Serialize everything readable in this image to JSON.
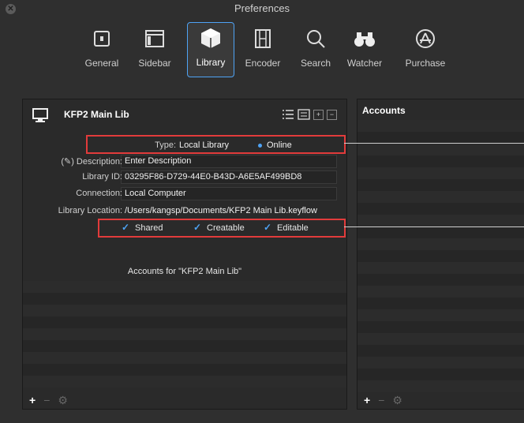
{
  "window": {
    "title": "Preferences",
    "close_glyph": "✕"
  },
  "toolbar": {
    "items": [
      {
        "label": "General",
        "icon": "general-icon"
      },
      {
        "label": "Sidebar",
        "icon": "sidebar-icon"
      },
      {
        "label": "Library",
        "icon": "library-icon",
        "active": true
      },
      {
        "label": "Encoder",
        "icon": "encoder-icon"
      },
      {
        "label": "Search",
        "icon": "search-icon"
      },
      {
        "label": "Watcher",
        "icon": "binoculars-icon"
      },
      {
        "label": "Purchase",
        "icon": "app-store-icon"
      }
    ]
  },
  "library": {
    "title": "KFP2 Main Lib",
    "type_label": "Type:",
    "type_value": "Local Library",
    "status": "Online",
    "description_label": "(✎) Description:",
    "description_placeholder": "Enter Description",
    "id_label": "Library ID:",
    "id_value": "03295F86-D729-44E0-B43D-A6E5AF499BD8",
    "connection_label": "Connection:",
    "connection_value": "Local Computer",
    "location_label": "Library Location:",
    "location_value": "/Users/kangsp/Documents/KFP2 Main Lib.keyflow",
    "checkboxes": [
      {
        "label": "Shared",
        "checked": true
      },
      {
        "label": "Creatable",
        "checked": true
      },
      {
        "label": "Editable",
        "checked": true
      }
    ],
    "accounts_for": "Accounts for \"KFP2 Main Lib\""
  },
  "accounts": {
    "title": "Accounts"
  },
  "bottom_bar": {
    "add": "+",
    "remove": "−",
    "gear": "⚙"
  },
  "colors": {
    "accent": "#4ea3f5",
    "highlight": "#e23b3b"
  }
}
